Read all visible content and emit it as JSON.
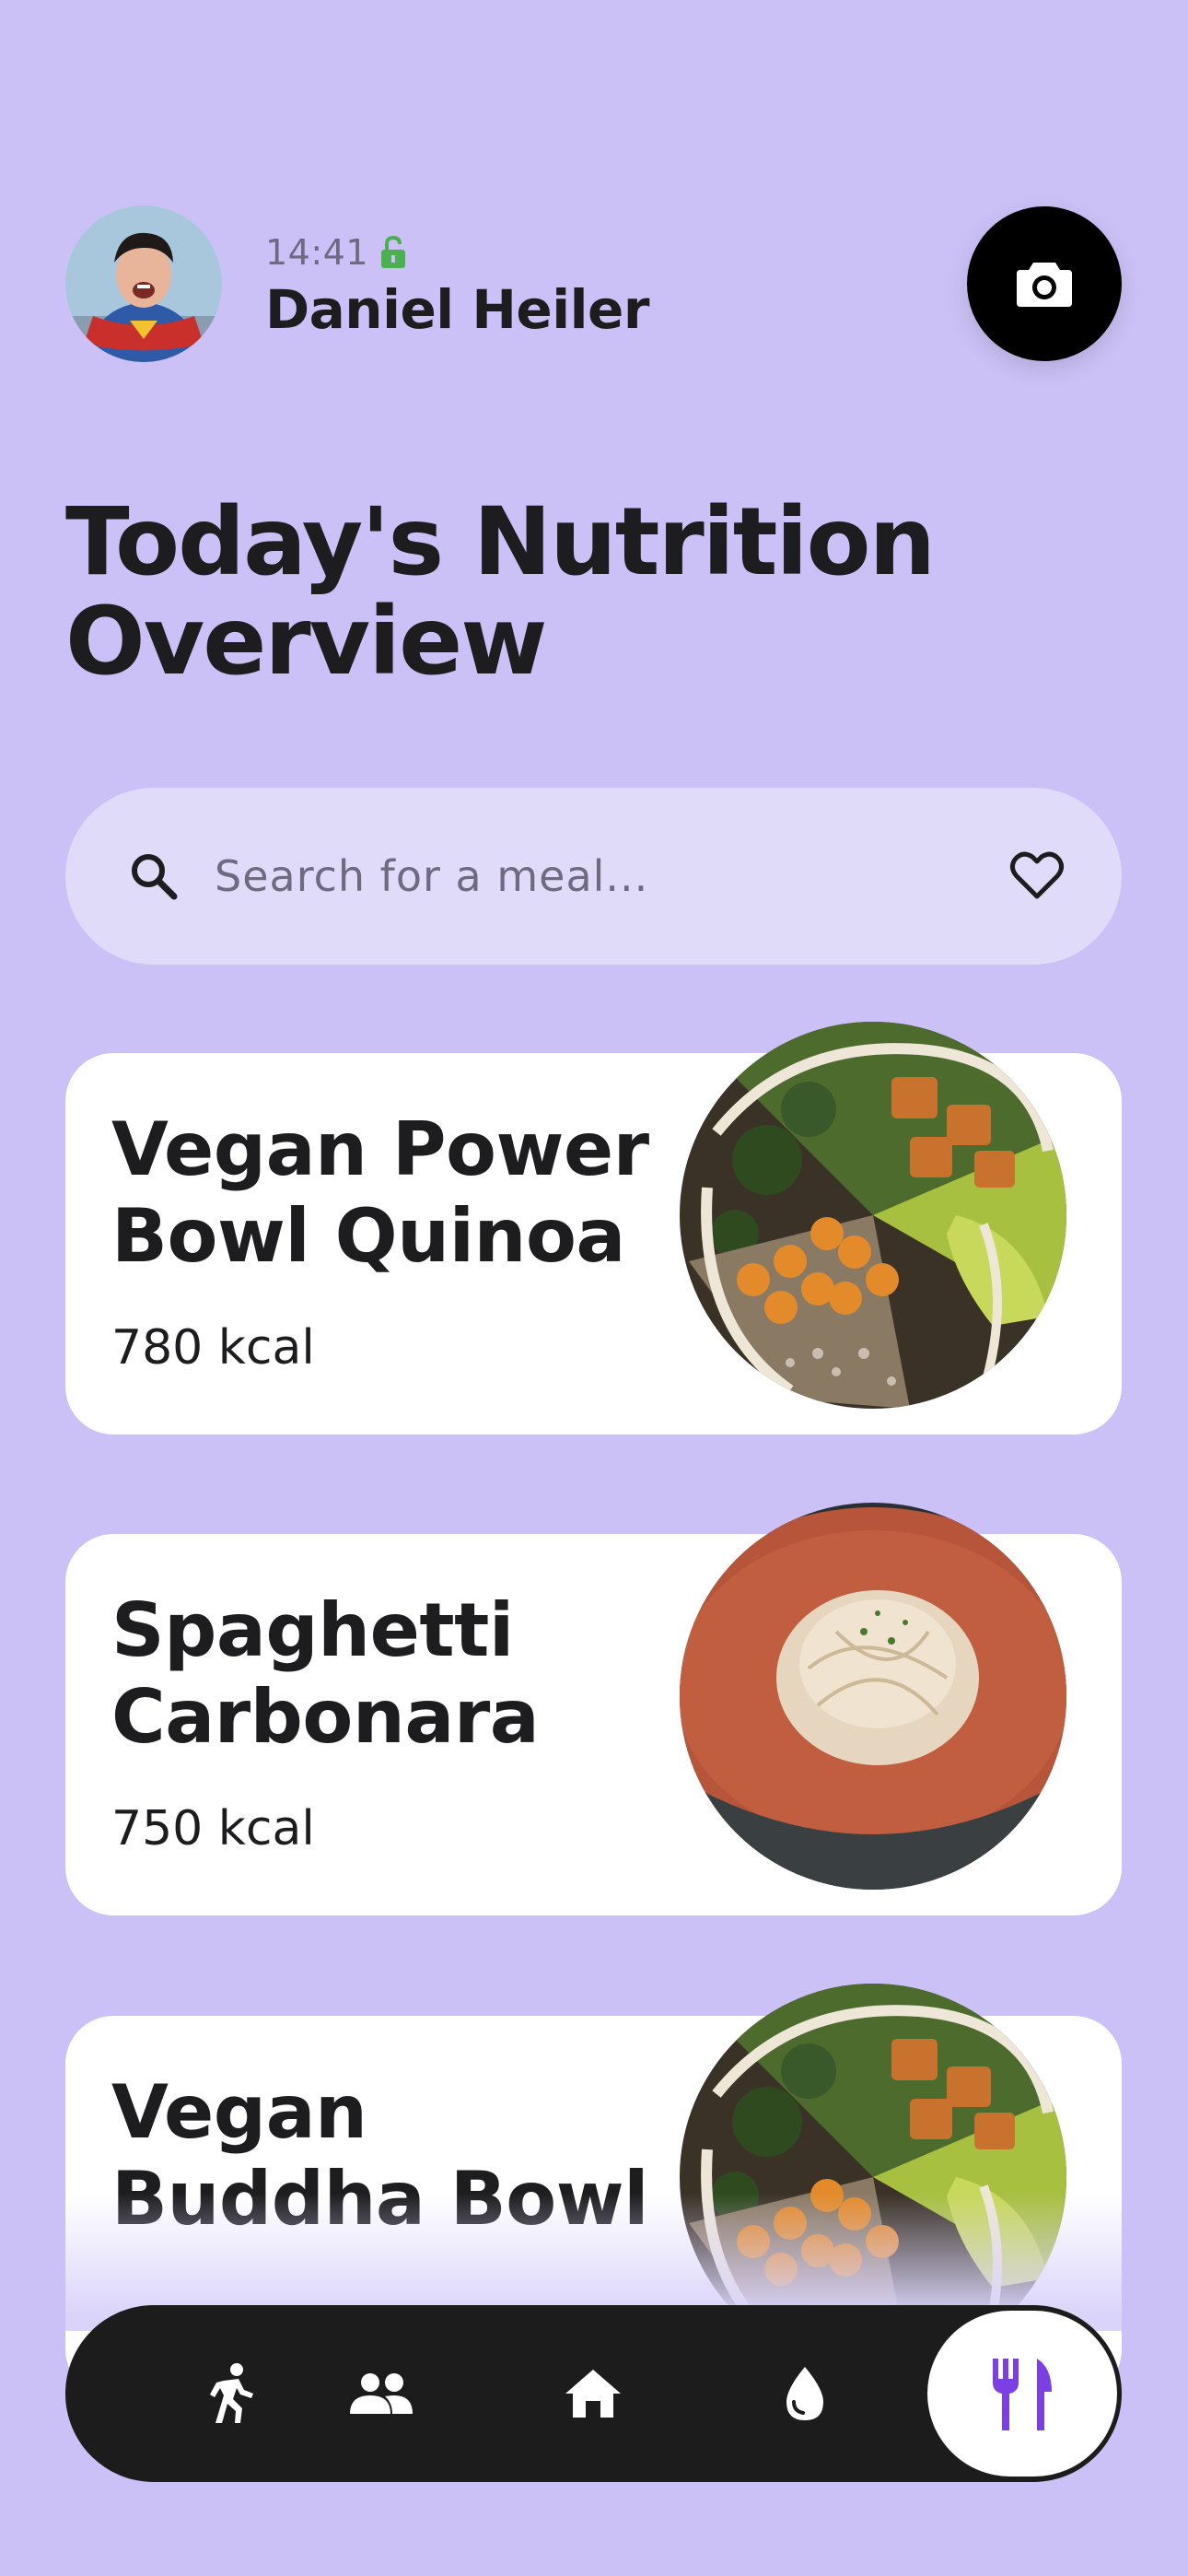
{
  "header": {
    "status_time": "14:41",
    "user_name": "Daniel Heiler",
    "avatar_icon": "avatar",
    "camera_icon": "camera-icon"
  },
  "page_title": "Today's Nutrition Overview",
  "search": {
    "placeholder": "Search for a meal...",
    "value": "",
    "search_icon": "search-icon",
    "favorite_icon": "heart-icon"
  },
  "meals": [
    {
      "title": "Vegan Power Bowl Quinoa",
      "kcal": "780 kcal",
      "image": "power-bowl"
    },
    {
      "title": "Spaghetti Carbonara",
      "kcal": "750 kcal",
      "image": "pasta-plate"
    },
    {
      "title": "Vegan Buddha Bowl",
      "kcal": "",
      "image": "buddha-bowl"
    }
  ],
  "bottom_nav": {
    "items": [
      "run-icon",
      "group-icon",
      "home-icon",
      "water-drop-icon",
      "fork-knife-icon"
    ],
    "active": "fork-knife-icon"
  },
  "colors": {
    "background": "#CBC1F6",
    "search_bg": "#E0DBF9",
    "card_bg": "#FFFFFF",
    "nav_bg": "#1B1C1B",
    "accent": "#7B3FE4",
    "lock_green": "#4CAF50"
  }
}
